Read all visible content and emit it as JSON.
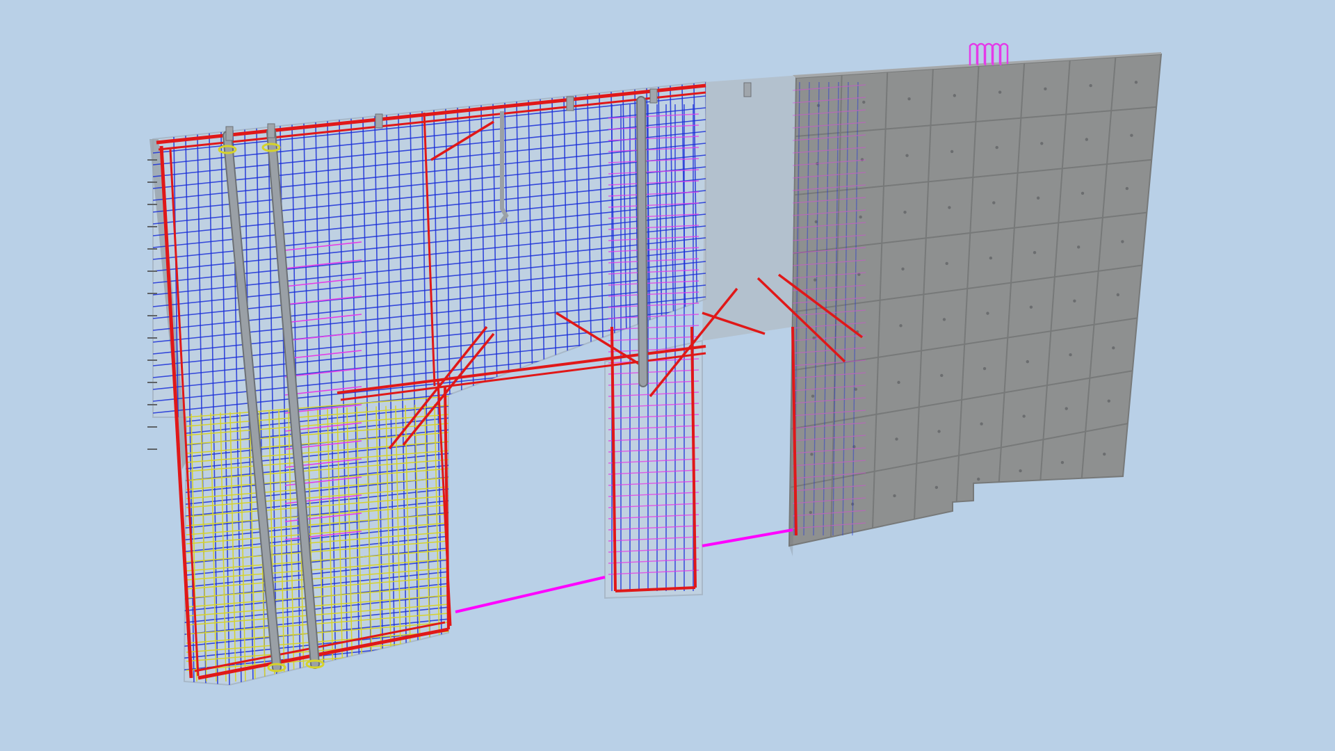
{
  "viewport": {
    "background": "#b9d0e7",
    "scene": "reinforced-concrete-wall-3d-model"
  },
  "colors": {
    "concrete": "#8e9090",
    "concrete_dark": "#777979",
    "concrete_ghost": "#c4d2de",
    "rebar_red": "#e01818",
    "rebar_orange": "#f07a20",
    "rebar_blue": "#1a2fd8",
    "rebar_magenta": "#e43be8",
    "rebar_yellow": "#d6d22a",
    "pipe_grey": "#9aa0a6",
    "link_magenta": "#ff00ff"
  },
  "components": [
    {
      "id": "wall-panel-left",
      "material": "concrete-transparent",
      "reinforcement": [
        "red",
        "blue",
        "magenta",
        "yellow",
        "orange"
      ]
    },
    {
      "id": "wall-pier-middle",
      "material": "concrete-transparent",
      "reinforcement": [
        "red",
        "blue",
        "magenta"
      ]
    },
    {
      "id": "wall-panel-right",
      "material": "concrete-solid"
    },
    {
      "id": "door-opening-1"
    },
    {
      "id": "door-opening-2"
    },
    {
      "id": "lifting-anchor-top"
    },
    {
      "id": "connection-line",
      "color": "magenta"
    }
  ]
}
